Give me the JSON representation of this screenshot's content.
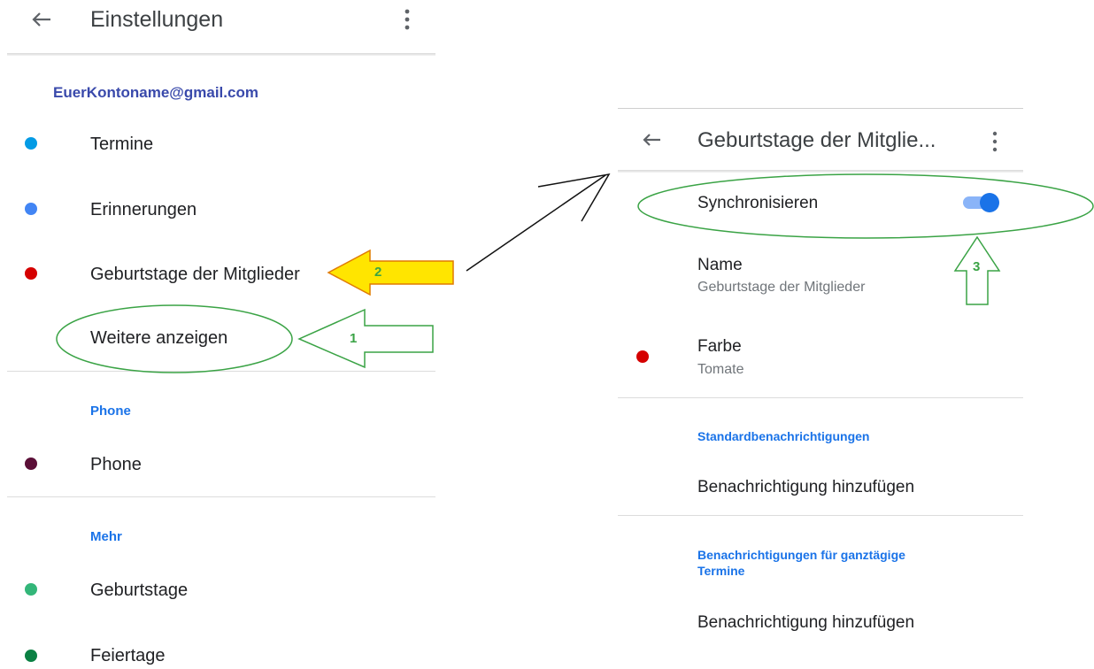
{
  "left": {
    "header": {
      "title": "Einstellungen"
    },
    "account": "EuerKontoname@gmail.com",
    "account_items": [
      {
        "label": "Termine",
        "color": "#039be5"
      },
      {
        "label": "Erinnerungen",
        "color": "#4285f4"
      },
      {
        "label": "Geburtstage der Mitglieder",
        "color": "#d50000"
      }
    ],
    "more_link": "Weitere anzeigen",
    "phone_section": {
      "title": "Phone",
      "items": [
        {
          "label": "Phone",
          "color": "#5b0f37"
        }
      ]
    },
    "more_section": {
      "title": "Mehr",
      "items": [
        {
          "label": "Geburtstage",
          "color": "#33b679"
        },
        {
          "label": "Feiertage",
          "color": "#0b8043"
        }
      ]
    }
  },
  "right": {
    "header": {
      "title": "Geburtstage der Mitglie..."
    },
    "sync": {
      "label": "Synchronisieren",
      "enabled": true
    },
    "name": {
      "label": "Name",
      "value": "Geburtstage der Mitglieder"
    },
    "color": {
      "label": "Farbe",
      "value": "Tomate",
      "swatch": "#d50000"
    },
    "default_notifications": {
      "title": "Standardbenachrichtigungen",
      "action": "Benachrichtigung hinzufügen"
    },
    "allday_notifications": {
      "title_line1": "Benachrichtigungen für ganztägige",
      "title_line2": "Termine",
      "action": "Benachrichtigung hinzufügen"
    }
  },
  "annotations": {
    "step1": "1",
    "step2": "2",
    "step3": "3"
  },
  "colors": {
    "accent": "#1a73e8",
    "account_header": "#3949ab",
    "annotation_green": "#3aa345",
    "annotation_yellow": "#ffe500"
  }
}
